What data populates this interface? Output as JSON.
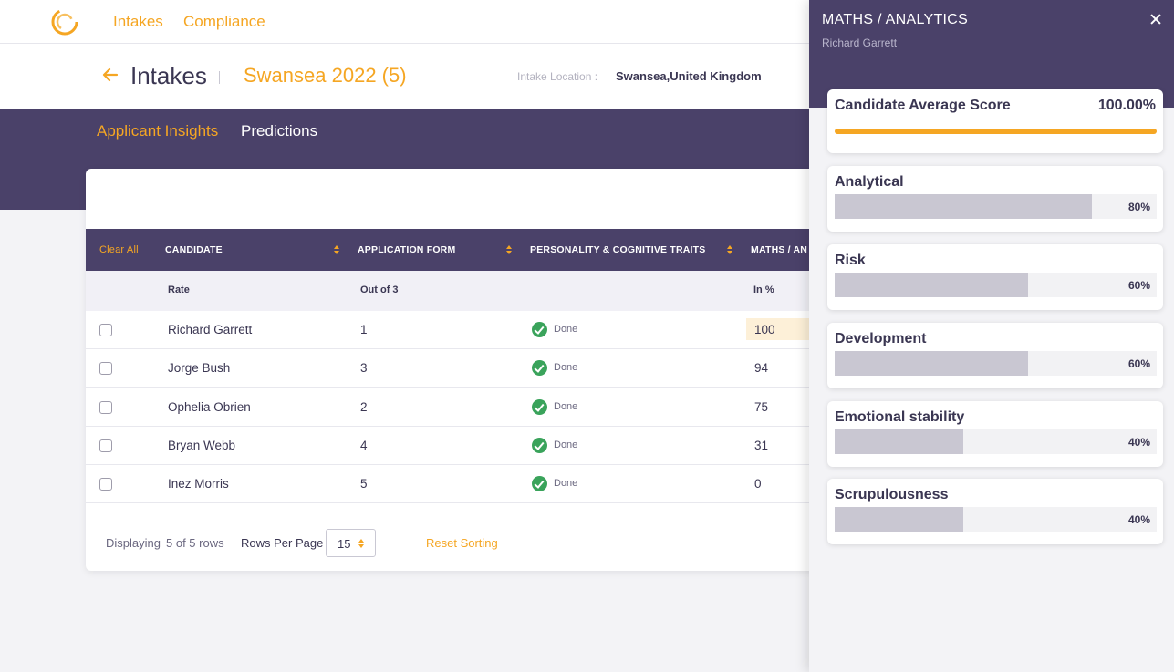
{
  "nav": {
    "items": [
      "Intakes",
      "Compliance"
    ]
  },
  "header": {
    "title": "Intakes",
    "intake_name": "Swansea 2022 (5)",
    "location_label": "Intake Location :",
    "location_value": "Swansea,United Kingdom"
  },
  "tabs": {
    "active": "Applicant Insights",
    "other": "Predictions"
  },
  "table": {
    "clear_all": "Clear All",
    "headers": [
      "CANDIDATE",
      "APPLICATION FORM",
      "PERSONALITY & COGNITIVE TRAITS",
      "MATHS / AN"
    ],
    "subheaders": [
      "Rate",
      "Out of 3",
      "In %"
    ],
    "rows": [
      {
        "name": "Richard Garrett",
        "form": "1",
        "traits": "Done",
        "maths": "100"
      },
      {
        "name": "Jorge Bush",
        "form": "3",
        "traits": "Done",
        "maths": "94"
      },
      {
        "name": "Ophelia Obrien",
        "form": "2",
        "traits": "Done",
        "maths": "75"
      },
      {
        "name": "Bryan Webb",
        "form": "4",
        "traits": "Done",
        "maths": "31"
      },
      {
        "name": "Inez Morris",
        "form": "5",
        "traits": "Done",
        "maths": "0"
      }
    ]
  },
  "footer": {
    "displaying_prefix": "Displaying",
    "displaying_count": "5 of 5 rows",
    "rows_per_page_label": "Rows Per Page",
    "rows_per_page_value": "15",
    "reset_label": "Reset Sorting"
  },
  "panel": {
    "title": "MATHS / ANALYTICS",
    "subtitle": "Richard Garrett",
    "average": {
      "label": "Candidate Average Score",
      "value": "100.00%",
      "fraction": 1.0
    },
    "metrics": [
      {
        "label": "Analytical",
        "value": "80%",
        "fraction": 0.8
      },
      {
        "label": "Risk",
        "value": "60%",
        "fraction": 0.6
      },
      {
        "label": "Development",
        "value": "60%",
        "fraction": 0.6
      },
      {
        "label": "Emotional stability",
        "value": "40%",
        "fraction": 0.4
      },
      {
        "label": "Scrupulousness",
        "value": "40%",
        "fraction": 0.4
      }
    ]
  },
  "colors": {
    "accent": "#f5a623",
    "brand_purple": "#4a4169",
    "done_green": "#3aa35b"
  },
  "icons": {
    "logo": "swirl-logo-icon",
    "back": "arrow-left-icon",
    "close": "close-icon",
    "done": "check-circle-icon",
    "sort": "sort-icon"
  }
}
